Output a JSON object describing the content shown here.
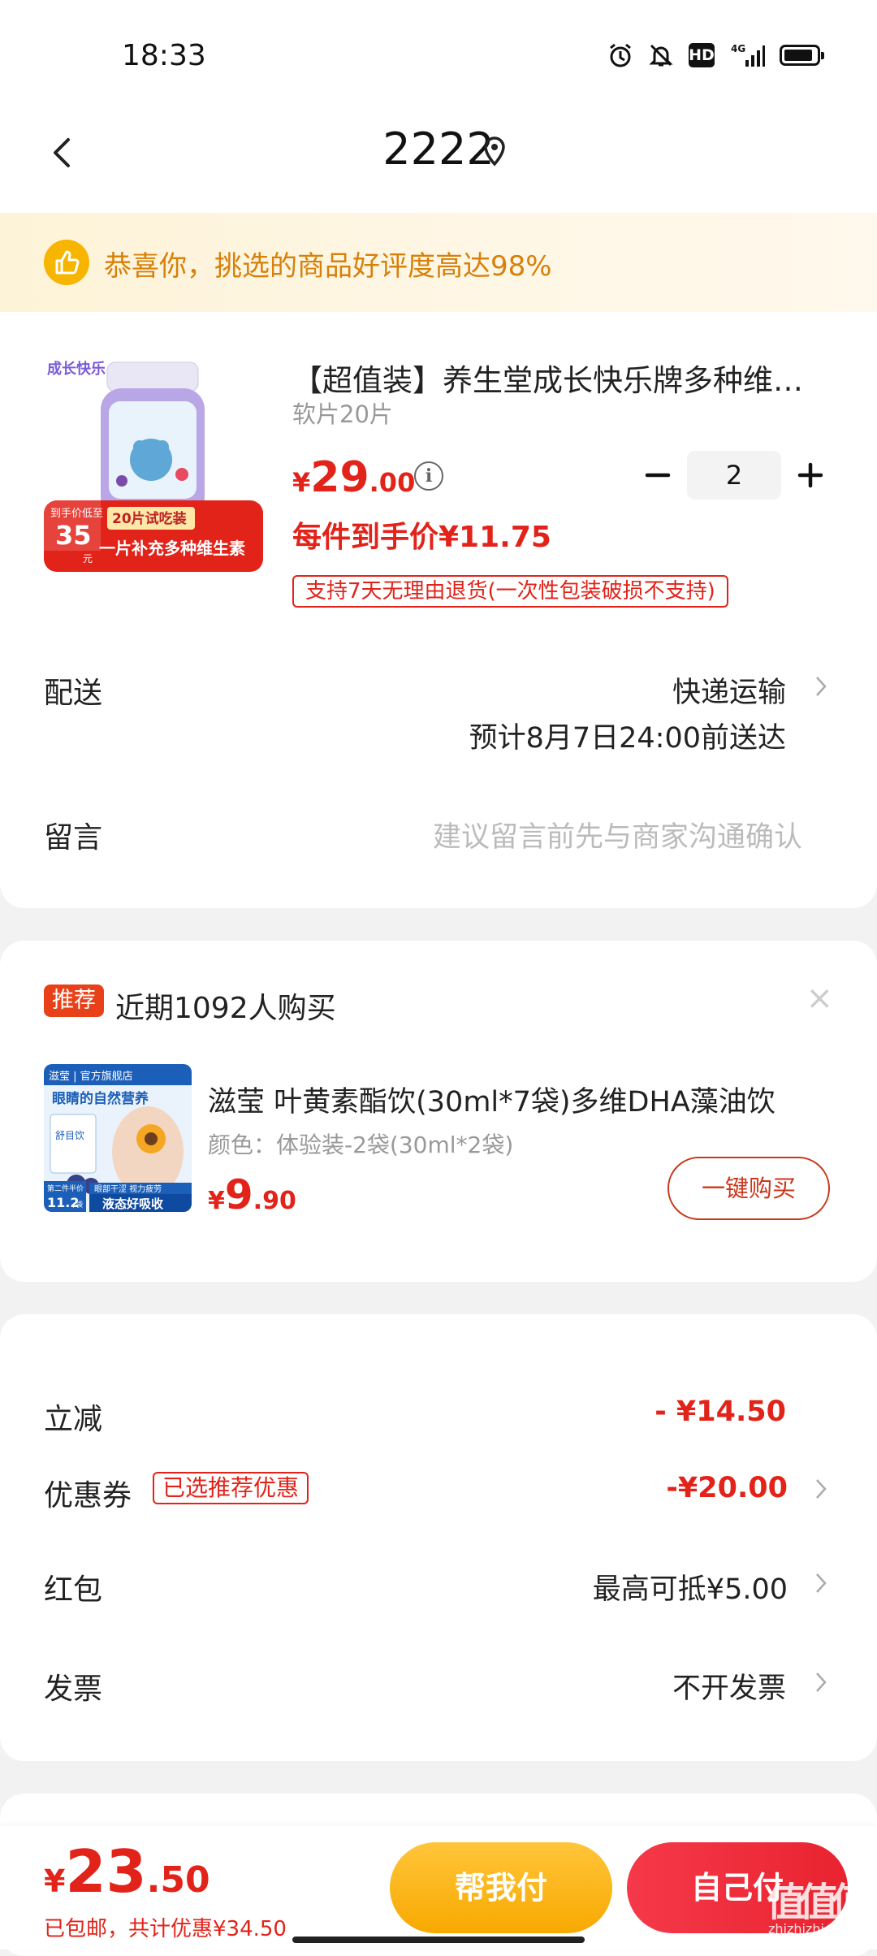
{
  "status_bar": {
    "time": "18:33",
    "hd": "HD",
    "network": "4G"
  },
  "header": {
    "title": "2222"
  },
  "banner": {
    "text": "恭喜你，挑选的商品好评度高达98%"
  },
  "product": {
    "title": "【超值装】养生堂成长快乐牌多种维生素咀嚼片",
    "spec": "软片20片",
    "price_currency": "¥",
    "price_int": "29",
    "price_dec": ".00",
    "quantity": "2",
    "unit_price": "每件到手价¥11.75",
    "return_policy": "支持7天无理由退货(一次性包装破损不支持)",
    "image": {
      "brand": "成长快乐",
      "badge_top": "到手价低至",
      "badge_num": "35",
      "badge_unit": "元",
      "tag1": "20片试吃装",
      "tag2": "一片补充多种维生素"
    }
  },
  "delivery": {
    "label": "配送",
    "method": "快递运输",
    "eta": "预计8月7日24:00前送达"
  },
  "message": {
    "label": "留言",
    "placeholder": "建议留言前先与商家沟通确认"
  },
  "recommend": {
    "badge": "推荐",
    "text": "近期1092人购买",
    "close": "×",
    "item_title": "滋莹 叶黄素酯饮(30ml*7袋)多维DHA藻油饮",
    "item_spec": "颜色：体验装-2袋(30ml*2袋)",
    "price_currency": "¥",
    "price_int": "9",
    "price_dec": ".90",
    "buy_label": "一键购买",
    "image": {
      "store": "滋莹 | 官方旗舰店",
      "headline": "眼睛的自然营养",
      "pkg": "舒目饮",
      "promo_top": "第二件半价",
      "promo_num": "11.2",
      "promo_unit": "/袋",
      "bar1": "眼部干涩 视力疲劳",
      "bar2": "液态好吸收"
    }
  },
  "summary": {
    "discount_label": "立减",
    "discount_value": "- ¥14.50",
    "coupon_label": "优惠券",
    "coupon_tag": "已选推荐优惠",
    "coupon_value": "-¥20.00",
    "redpacket_label": "红包",
    "redpacket_value": "最高可抵¥5.00",
    "invoice_label": "发票",
    "invoice_value": "不开发票"
  },
  "bottom": {
    "total_currency": "¥",
    "total_int": "23",
    "total_dec": ".50",
    "total_sub": "已包邮，共计优惠¥34.50",
    "help_pay": "帮我付",
    "self_pay": "自己付"
  },
  "watermark": {
    "text": "值",
    "site": "zhizhizhi.com"
  },
  "colors": {
    "accent_red": "#e2231a",
    "accent_yellow": "#f8a900",
    "banner_text": "#d7800a"
  }
}
